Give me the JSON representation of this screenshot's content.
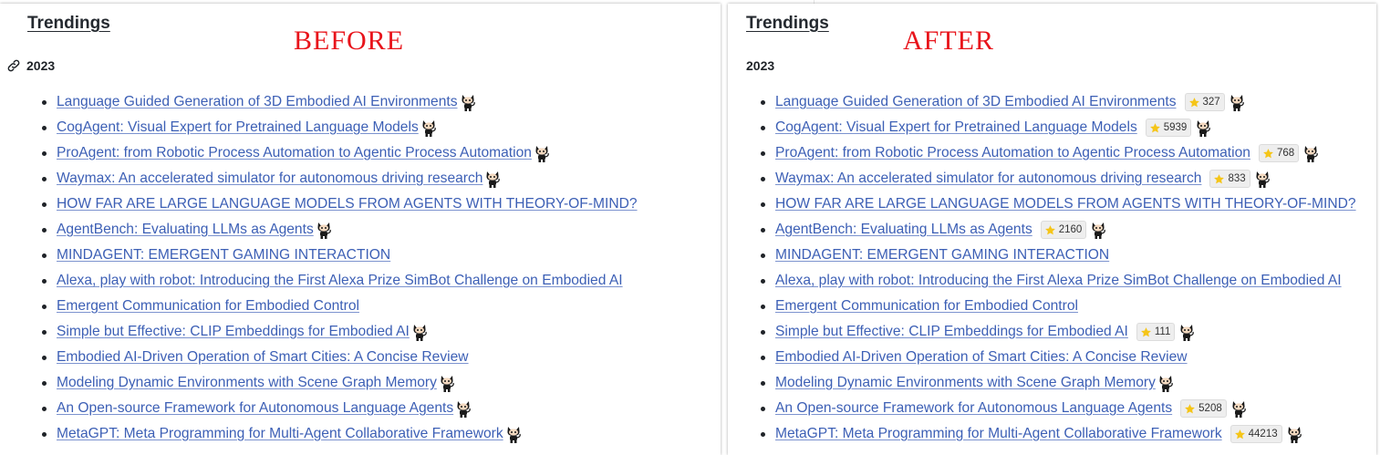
{
  "before": {
    "heading": "Trendings",
    "stamp": "BEFORE",
    "year": "2023",
    "papers": [
      {
        "title": "Language Guided Generation of 3D Embodied AI Environments",
        "github": true
      },
      {
        "title": "CogAgent: Visual Expert for Pretrained Language Models",
        "github": true
      },
      {
        "title": "ProAgent: from Robotic Process Automation to Agentic Process Automation",
        "github": true
      },
      {
        "title": "Waymax: An accelerated simulator for autonomous driving research",
        "github": true
      },
      {
        "title": "HOW FAR ARE LARGE LANGUAGE MODELS FROM AGENTS WITH THEORY-OF-MIND?",
        "github": false
      },
      {
        "title": "AgentBench: Evaluating LLMs as Agents",
        "github": true
      },
      {
        "title": "MINDAGENT: EMERGENT GAMING INTERACTION",
        "github": false
      },
      {
        "title": "Alexa, play with robot: Introducing the First Alexa Prize SimBot Challenge on Embodied AI",
        "github": false
      },
      {
        "title": "Emergent Communication for Embodied Control",
        "github": false
      },
      {
        "title": "Simple but Effective: CLIP Embeddings for Embodied AI",
        "github": true
      },
      {
        "title": "Embodied AI-Driven Operation of Smart Cities: A Concise Review",
        "github": false
      },
      {
        "title": "Modeling Dynamic Environments with Scene Graph Memory",
        "github": true
      },
      {
        "title": "An Open-source Framework for Autonomous Language Agents",
        "github": true
      },
      {
        "title": "MetaGPT: Meta Programming for Multi-Agent Collaborative Framework",
        "github": true
      }
    ]
  },
  "after": {
    "heading": "Trendings",
    "stamp": "AFTER",
    "year": "2023",
    "papers": [
      {
        "title": "Language Guided Generation of 3D Embodied AI Environments",
        "stars": "327",
        "github": true
      },
      {
        "title": "CogAgent: Visual Expert for Pretrained Language Models",
        "stars": "5939",
        "github": true
      },
      {
        "title": "ProAgent: from Robotic Process Automation to Agentic Process Automation",
        "stars": "768",
        "github": true
      },
      {
        "title": "Waymax: An accelerated simulator for autonomous driving research",
        "stars": "833",
        "github": true
      },
      {
        "title": "HOW FAR ARE LARGE LANGUAGE MODELS FROM AGENTS WITH THEORY-OF-MIND?",
        "stars": "",
        "github": false
      },
      {
        "title": "AgentBench: Evaluating LLMs as Agents",
        "stars": "2160",
        "github": true
      },
      {
        "title": "MINDAGENT: EMERGENT GAMING INTERACTION",
        "stars": "",
        "github": false
      },
      {
        "title": "Alexa, play with robot: Introducing the First Alexa Prize SimBot Challenge on Embodied AI",
        "stars": "",
        "github": false
      },
      {
        "title": "Emergent Communication for Embodied Control",
        "stars": "",
        "github": false
      },
      {
        "title": "Simple but Effective: CLIP Embeddings for Embodied AI",
        "stars": "111",
        "github": true
      },
      {
        "title": "Embodied AI-Driven Operation of Smart Cities: A Concise Review",
        "stars": "",
        "github": false
      },
      {
        "title": "Modeling Dynamic Environments with Scene Graph Memory",
        "stars": "",
        "github": true
      },
      {
        "title": "An Open-source Framework for Autonomous Language Agents",
        "stars": "5208",
        "github": true
      },
      {
        "title": "MetaGPT: Meta Programming for Multi-Agent Collaborative Framework",
        "stars": "44213",
        "github": true
      }
    ]
  },
  "icons": {
    "github": "octocat-icon",
    "star": "star-icon",
    "anchor": "link-icon"
  },
  "colors": {
    "link": "#3c5fb5",
    "stamp": "#e8141b",
    "star": "#f5c518",
    "badge_bg": "#eeeeee"
  }
}
